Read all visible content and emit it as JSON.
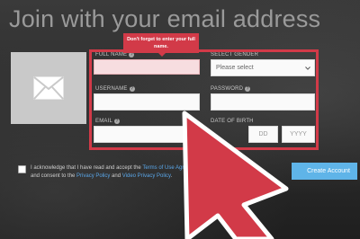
{
  "heading": "Join with your email address",
  "tooltip": {
    "text": "Don't forget to enter your full name."
  },
  "form": {
    "full_name_label": "FULL NAME",
    "select_gender_label": "SELECT GENDER",
    "gender_value": "Please select",
    "username_label": "USERNAME",
    "password_label": "PASSWORD",
    "email_label": "EMAIL",
    "dob_label": "DATE OF BIRTH",
    "dob_dd_placeholder": "DD",
    "dob_yyyy_placeholder": "YYYY"
  },
  "ack": {
    "text_prefix": "I acknowledge that I have read and accept the ",
    "terms_link": "Terms of Use Agreement",
    "text_mid": " and consent to the ",
    "privacy_link": "Privacy Policy",
    "text_and": " and ",
    "video_privacy_link": "Video Privacy Policy",
    "text_end": "."
  },
  "create_account_label": "Create Account",
  "colors": {
    "accent_red": "#d23a48",
    "link_blue": "#5aa6e8",
    "button_blue": "#5fb4e8"
  }
}
